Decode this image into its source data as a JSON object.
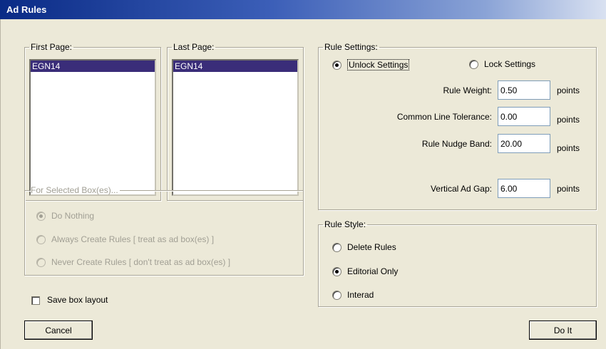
{
  "window": {
    "title": "Ad Rules"
  },
  "first_page": {
    "label": "First Page:",
    "items": [
      "EGN14"
    ]
  },
  "last_page": {
    "label": "Last Page:",
    "items": [
      "EGN14"
    ]
  },
  "selected_box": {
    "label": "For Selected Box(es)...",
    "options": [
      {
        "label": "Do Nothing",
        "checked": true
      },
      {
        "label": "Always Create Rules [ treat as ad box(es) ]",
        "checked": false
      },
      {
        "label": "Never Create Rules [ don't treat as ad box(es) ]",
        "checked": false
      }
    ]
  },
  "save_layout": {
    "label": "Save box layout",
    "checked": false
  },
  "rule_settings": {
    "label": "Rule Settings:",
    "unlock_label": "Unlock Settings",
    "lock_label": "Lock Settings",
    "selected": "unlock",
    "fields": {
      "rule_weight": {
        "label": "Rule Weight:",
        "value": "0.50",
        "unit": "points"
      },
      "common_line_tolerance": {
        "label": "Common Line Tolerance:",
        "value": "0.00",
        "unit": "points"
      },
      "rule_nudge_band": {
        "label": "Rule Nudge Band:",
        "value": "20.00",
        "unit": "points"
      },
      "vertical_ad_gap": {
        "label": "Vertical Ad Gap:",
        "value": "6.00",
        "unit": "points"
      }
    }
  },
  "rule_style": {
    "label": "Rule Style:",
    "options": [
      {
        "label": "Delete Rules",
        "checked": false
      },
      {
        "label": "Editorial Only",
        "checked": true
      },
      {
        "label": "Interad",
        "checked": false
      }
    ]
  },
  "buttons": {
    "cancel": "Cancel",
    "do_it": "Do It"
  }
}
